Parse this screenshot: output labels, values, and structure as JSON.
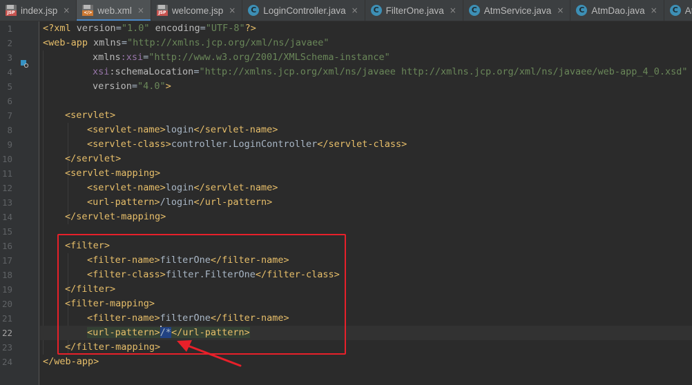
{
  "tabs": [
    {
      "label": "index.jsp",
      "icon": "jsp-file-icon",
      "active": false
    },
    {
      "label": "web.xml",
      "icon": "xml-file-icon",
      "active": true
    },
    {
      "label": "welcome.jsp",
      "icon": "jsp-file-icon",
      "active": false
    },
    {
      "label": "LoginController.java",
      "icon": "java-class-icon",
      "active": false
    },
    {
      "label": "FilterOne.java",
      "icon": "java-class-icon",
      "active": false
    },
    {
      "label": "AtmService.java",
      "icon": "java-class-icon",
      "active": false
    },
    {
      "label": "AtmDao.java",
      "icon": "java-class-icon",
      "active": false
    },
    {
      "label": "Atm.java",
      "icon": "java-class-icon",
      "active": false
    }
  ],
  "close_glyph": "×",
  "editor": {
    "current_line": 22,
    "line_numbers": [
      "1",
      "2",
      "3",
      "4",
      "5",
      "6",
      "7",
      "8",
      "9",
      "10",
      "11",
      "12",
      "13",
      "14",
      "15",
      "16",
      "17",
      "18",
      "19",
      "20",
      "21",
      "22",
      "23",
      "24"
    ],
    "lines": {
      "l1": {
        "a": "<?",
        "b": "xml ",
        "c": "version",
        "d": "=",
        "e": "\"1.0\"",
        "f": " encoding",
        "g": "=",
        "h": "\"UTF-8\"",
        "i": "?>"
      },
      "l2": {
        "a": "<web-app",
        "b": " xmlns",
        "c": "=",
        "d": "\"http://xmlns.jcp.org/xml/ns/javaee\""
      },
      "l3": {
        "a": "xmlns",
        "b": ":xsi",
        "c": "=",
        "d": "\"http://www.w3.org/2001/XMLSchema-instance\""
      },
      "l4": {
        "a": "xsi",
        "b": ":schemaLocation",
        "c": "=",
        "d": "\"http://xmlns.jcp.org/xml/ns/javaee http://xmlns.jcp.org/xml/ns/javaee/web-app_4_0.xsd\""
      },
      "l5": {
        "a": "version",
        "b": "=",
        "c": "\"4.0\"",
        "d": ">"
      },
      "l7": {
        "a": "<servlet>"
      },
      "l8": {
        "a": "<servlet-name>",
        "b": "login",
        "c": "</servlet-name>"
      },
      "l9": {
        "a": "<servlet-class>",
        "b": "controller.LoginController",
        "c": "</servlet-class>"
      },
      "l10": {
        "a": "</servlet>"
      },
      "l11": {
        "a": "<servlet-mapping>"
      },
      "l12": {
        "a": "<servlet-name>",
        "b": "login",
        "c": "</servlet-name>"
      },
      "l13": {
        "a": "<url-pattern>",
        "b": "/login",
        "c": "</url-pattern>"
      },
      "l14": {
        "a": "</servlet-mapping>"
      },
      "l16": {
        "a": "<filter>"
      },
      "l17": {
        "a": "<filter-name>",
        "b": "filterOne",
        "c": "</filter-name>"
      },
      "l18": {
        "a": "<filter-class>",
        "b": "filter.FilterOne",
        "c": "</filter-class>"
      },
      "l19": {
        "a": "</filter>"
      },
      "l20": {
        "a": "<filter-mapping>"
      },
      "l21": {
        "a": "<filter-name>",
        "b": "filterOne",
        "c": "</filter-name>"
      },
      "l22": {
        "a": "<url-pattern>",
        "b": "/*",
        "c": "</url-pattern>"
      },
      "l23": {
        "a": "</filter-mapping>"
      },
      "l24": {
        "a": "</web-app>"
      }
    }
  },
  "colors": {
    "background": "#2b2b2b",
    "tag": "#e8bf6a",
    "attribute": "#bababa",
    "namespace": "#9876aa",
    "string": "#6a8759",
    "text": "#a9b7c6",
    "annotation": "#e8202a"
  }
}
